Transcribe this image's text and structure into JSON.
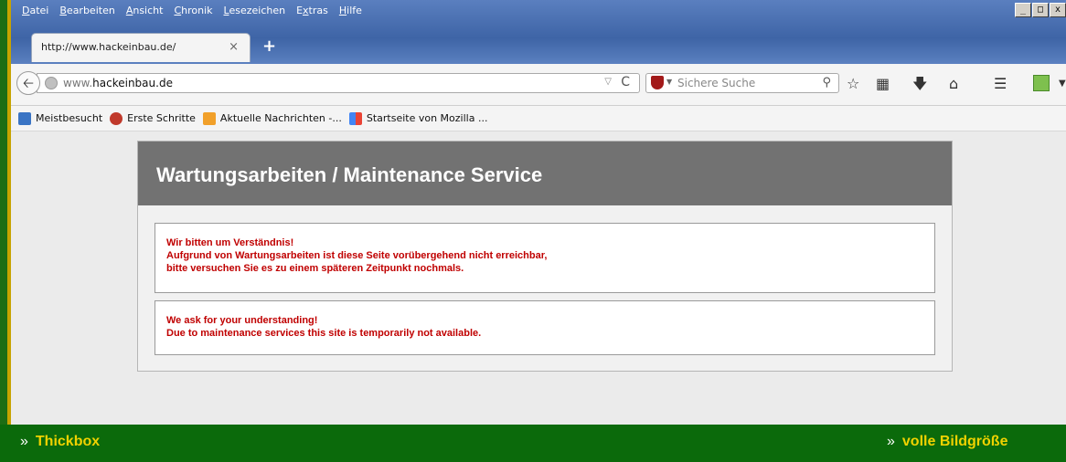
{
  "menu": [
    {
      "label": "Datei",
      "accel": "D",
      "rest": "atei"
    },
    {
      "label": "Bearbeiten",
      "accel": "B",
      "rest": "earbeiten"
    },
    {
      "label": "Ansicht",
      "accel": "A",
      "rest": "nsicht"
    },
    {
      "label": "Chronik",
      "accel": "C",
      "rest": "hronik"
    },
    {
      "label": "Lesezeichen",
      "accel": "L",
      "rest": "esezeichen"
    },
    {
      "label": "Extras",
      "accel": "x",
      "pre": "E",
      "rest": "tras"
    },
    {
      "label": "Hilfe",
      "accel": "H",
      "rest": "ilfe"
    }
  ],
  "window_buttons": {
    "minimize": "_",
    "maximize": "□",
    "close": "x"
  },
  "tab": {
    "title": "http://www.hackeinbau.de/",
    "close": "×",
    "new_tab": "+"
  },
  "url": {
    "prefix": "www.",
    "host": "hackeinbau.de",
    "dropdown": "▽",
    "reload": "C"
  },
  "search": {
    "placeholder": "Sichere Suche"
  },
  "toolbar_icons": [
    "star-icon",
    "reading-list-icon",
    "download-icon",
    "home-icon",
    "menu-icon",
    "addon-icon"
  ],
  "bookmarks": [
    {
      "label": "Meistbesucht",
      "icon": "search-bookmark-icon",
      "color": "#3a74c4"
    },
    {
      "label": "Erste Schritte",
      "icon": "firefox-icon",
      "color": "#c0392b"
    },
    {
      "label": "Aktuelle Nachrichten -...",
      "icon": "rss-icon",
      "color": "#f1a02a"
    },
    {
      "label": "Startseite von Mozilla ...",
      "icon": "mozilla-icon",
      "color": "#6aa84f"
    }
  ],
  "page": {
    "title": "Wartungsarbeiten / Maintenance Service",
    "german": [
      "Wir bitten um Verständnis!",
      "Aufgrund von Wartungsarbeiten ist diese Seite vorübergehend nicht erreichbar,",
      "bitte versuchen Sie es zu einem späteren Zeitpunkt nochmals."
    ],
    "english": [
      "We ask for your understanding!",
      "Due to maintenance services this site is temporarily not available."
    ],
    "text_color": "#c00000"
  },
  "footer": {
    "left": "Thickbox",
    "right": "volle Bildgröße",
    "arrow": "»"
  }
}
